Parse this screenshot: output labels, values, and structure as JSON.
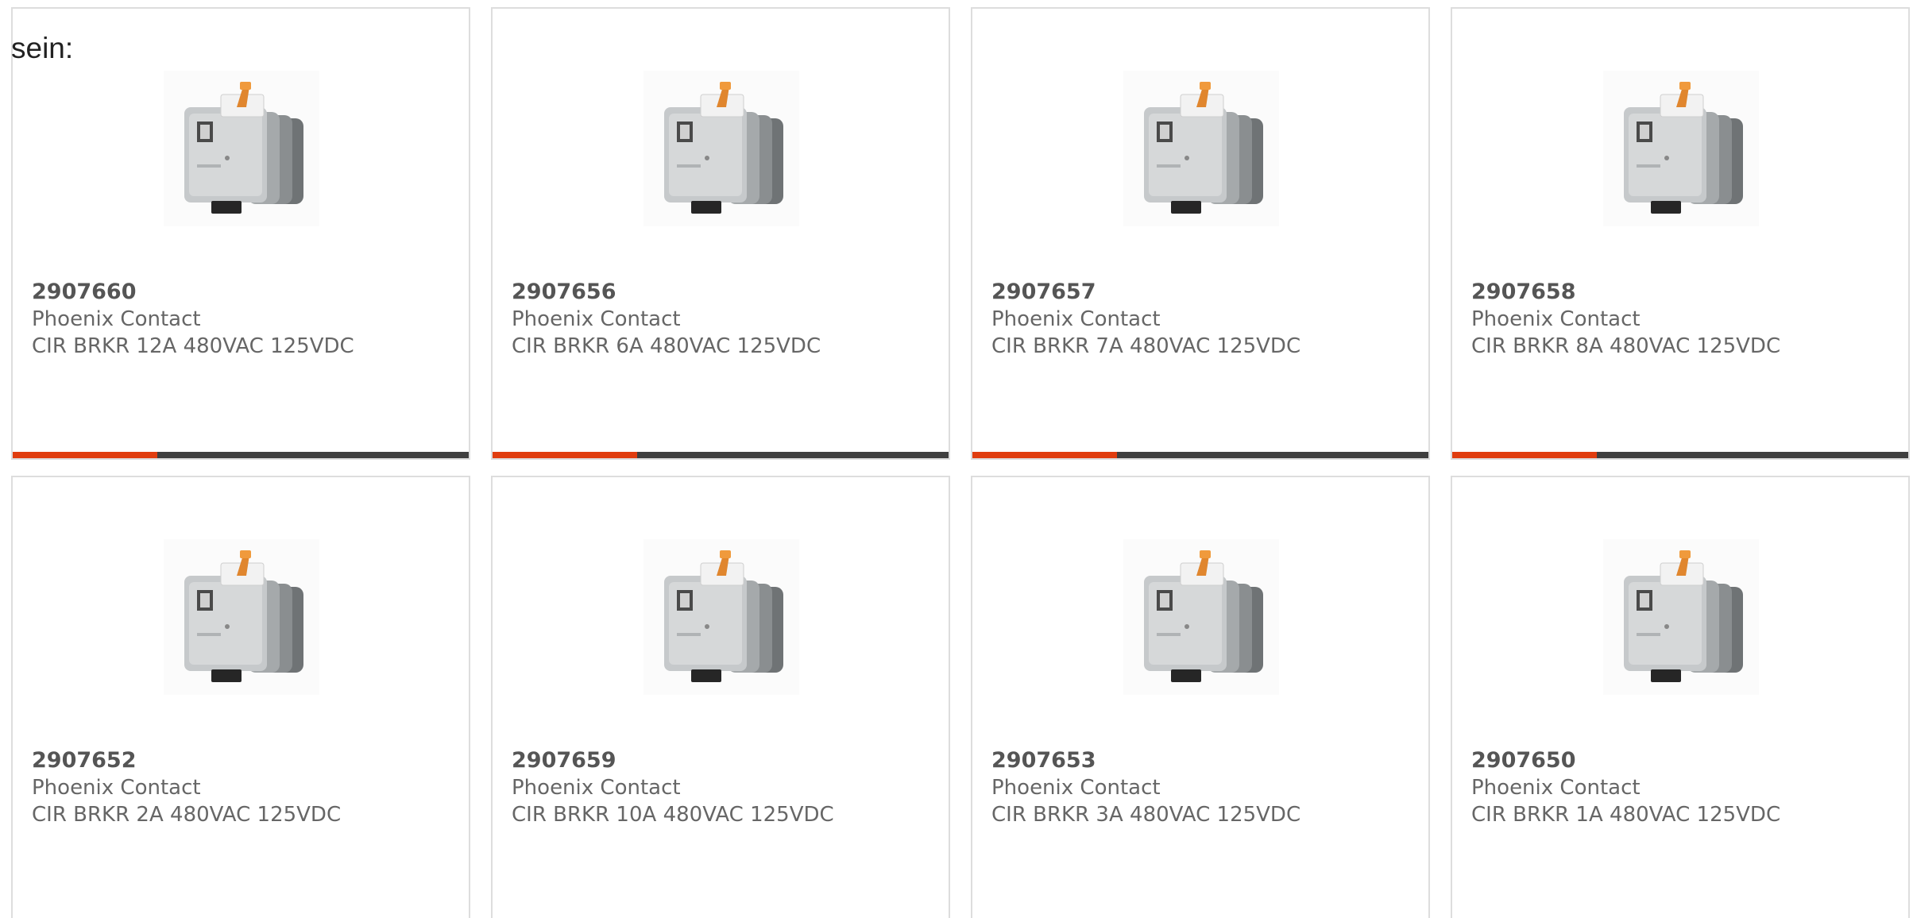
{
  "intro_text": "sein:",
  "products": [
    {
      "sku": "2907660",
      "manufacturer": "Phoenix Contact",
      "description": "CIR BRKR 12A 480VAC 125VDC"
    },
    {
      "sku": "2907656",
      "manufacturer": "Phoenix Contact",
      "description": "CIR BRKR 6A 480VAC 125VDC"
    },
    {
      "sku": "2907657",
      "manufacturer": "Phoenix Contact",
      "description": "CIR BRKR 7A 480VAC 125VDC"
    },
    {
      "sku": "2907658",
      "manufacturer": "Phoenix Contact",
      "description": "CIR BRKR 8A 480VAC 125VDC"
    },
    {
      "sku": "2907652",
      "manufacturer": "Phoenix Contact",
      "description": "CIR BRKR 2A 480VAC 125VDC"
    },
    {
      "sku": "2907659",
      "manufacturer": "Phoenix Contact",
      "description": "CIR BRKR 10A 480VAC 125VDC"
    },
    {
      "sku": "2907653",
      "manufacturer": "Phoenix Contact",
      "description": "CIR BRKR 3A 480VAC 125VDC"
    },
    {
      "sku": "2907650",
      "manufacturer": "Phoenix Contact",
      "description": "CIR BRKR 1A 480VAC 125VDC"
    }
  ],
  "colors": {
    "accent": "#e03d0f",
    "bar": "#3f3f3f",
    "border": "#dddddd",
    "text": "#555555"
  },
  "icons": {
    "product_image": "circuit-breaker-image"
  }
}
